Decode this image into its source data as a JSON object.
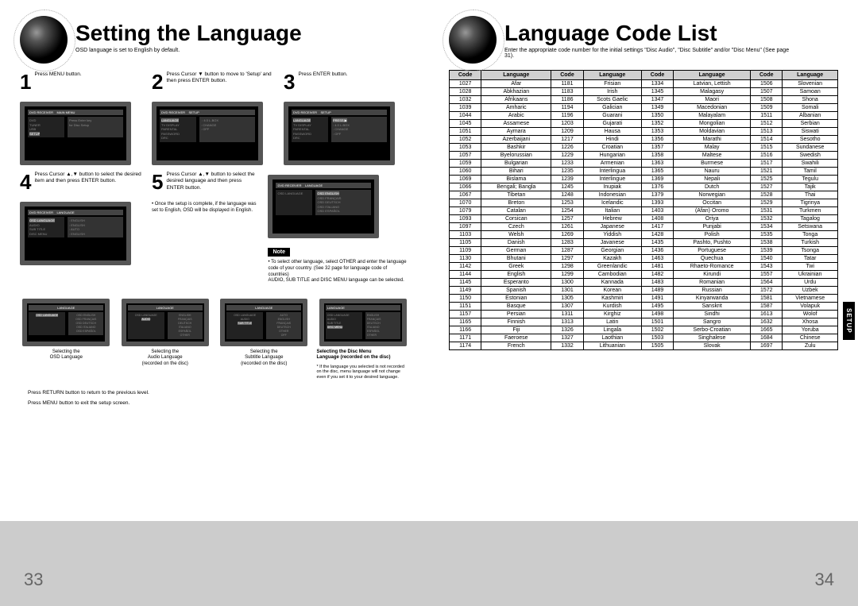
{
  "left": {
    "title": "Setting the Language",
    "subtitle": "OSD language is set to English by default.",
    "steps": {
      "s1": {
        "num": "1",
        "text": "Press MENU button."
      },
      "s2": {
        "num": "2",
        "text": "Press Cursor ▼ button to move to 'Setup' and then press ENTER button."
      },
      "s3": {
        "num": "3",
        "text": "Press ENTER button."
      },
      "s4": {
        "num": "4",
        "text": "Press Cursor ▲,▼ button to select the desired item and then press ENTER button."
      },
      "s5": {
        "num": "5",
        "text": "Press Cursor ▲,▼ button to select the desired language and then press ENTER button.",
        "sub": "• Once the setup is complete, if the language was set to English, OSD will be displayed in English."
      }
    },
    "note_label": "Note",
    "note_text": "• To select other language, select OTHER and enter the language code of your country. (See 32 page for language code of countries)\nAUDIO, SUB TITLE and DISC MENU language can be selected.",
    "bottom": {
      "b1": {
        "label1": "Selecting the",
        "label2": "OSD Language"
      },
      "b2": {
        "label1": "Selecting the",
        "label2": "Audio Language",
        "label3": "(recorded on the disc)"
      },
      "b3": {
        "label1": "Selecting the",
        "label2": "Subtitle Language",
        "label3": "(recorded on the disc)"
      },
      "b4": {
        "label1": "Selecting the Disc Menu",
        "label2": "Language (recorded on the disc)",
        "label3": "* If the language you selected is not recorded on the disc, menu language will not change even if you set it to your desired language."
      }
    },
    "footer1": "Press RETURN button to return to the previous level.",
    "footer2": "Press MENU button to exit the setup screen.",
    "page_num": "33"
  },
  "right": {
    "title": "Language Code List",
    "subtitle": "Enter the appropriate code number for the initial settings \"Disc Audio\", \"Disc Subtitle\" and/or \"Disc Menu\" (See page 31).",
    "headers": [
      "Code",
      "Language",
      "Code",
      "Language",
      "Code",
      "Language",
      "Code",
      "Language"
    ],
    "rows": [
      [
        "1027",
        "Afar",
        "1181",
        "Frisian",
        "1334",
        "Latvian, Lettish",
        "1506",
        "Slovenian"
      ],
      [
        "1028",
        "Abkhazian",
        "1183",
        "Irish",
        "1345",
        "Malagasy",
        "1507",
        "Samoan"
      ],
      [
        "1032",
        "Afrikaans",
        "1186",
        "Scots Gaelic",
        "1347",
        "Maori",
        "1508",
        "Shona"
      ],
      [
        "1039",
        "Amharic",
        "1194",
        "Galician",
        "1349",
        "Macedonian",
        "1509",
        "Somali"
      ],
      [
        "1044",
        "Arabic",
        "1196",
        "Guarani",
        "1350",
        "Malayalam",
        "1511",
        "Albanian"
      ],
      [
        "1045",
        "Assamese",
        "1203",
        "Gujarati",
        "1352",
        "Mongolian",
        "1512",
        "Serbian"
      ],
      [
        "1051",
        "Aymara",
        "1209",
        "Hausa",
        "1353",
        "Moldavian",
        "1513",
        "Siswati"
      ],
      [
        "1052",
        "Azerbaijani",
        "1217",
        "Hindi",
        "1356",
        "Marathi",
        "1514",
        "Sesotho"
      ],
      [
        "1053",
        "Bashkir",
        "1226",
        "Croatian",
        "1357",
        "Malay",
        "1515",
        "Sundanese"
      ],
      [
        "1057",
        "Byelorussian",
        "1229",
        "Hungarian",
        "1358",
        "Maltese",
        "1516",
        "Swedish"
      ],
      [
        "1059",
        "Bulgarian",
        "1233",
        "Armenian",
        "1363",
        "Burmese",
        "1517",
        "Swahili"
      ],
      [
        "1060",
        "Bihari",
        "1235",
        "Interlingua",
        "1365",
        "Nauru",
        "1521",
        "Tamil"
      ],
      [
        "1069",
        "Bislama",
        "1239",
        "Interlingue",
        "1369",
        "Nepali",
        "1525",
        "Tegulu"
      ],
      [
        "1066",
        "Bengali; Bangla",
        "1245",
        "Inupiak",
        "1376",
        "Dutch",
        "1527",
        "Tajik"
      ],
      [
        "1067",
        "Tibetan",
        "1248",
        "Indonesian",
        "1379",
        "Norwegian",
        "1528",
        "Thai"
      ],
      [
        "1070",
        "Breton",
        "1253",
        "Icelandic",
        "1393",
        "Occitan",
        "1529",
        "Tigrinya"
      ],
      [
        "1079",
        "Catalan",
        "1254",
        "Italian",
        "1403",
        "(Afan) Oromo",
        "1531",
        "Turkmen"
      ],
      [
        "1093",
        "Corsican",
        "1257",
        "Hebrew",
        "1408",
        "Oriya",
        "1532",
        "Tagalog"
      ],
      [
        "1097",
        "Czech",
        "1261",
        "Japanese",
        "1417",
        "Punjabi",
        "1534",
        "Setswana"
      ],
      [
        "1103",
        "Welsh",
        "1269",
        "Yiddish",
        "1428",
        "Polish",
        "1535",
        "Tonga"
      ],
      [
        "1105",
        "Danish",
        "1283",
        "Javanese",
        "1435",
        "Pashto, Pushto",
        "1538",
        "Turkish"
      ],
      [
        "1109",
        "German",
        "1287",
        "Georgian",
        "1436",
        "Portuguese",
        "1539",
        "Tsonga"
      ],
      [
        "1130",
        "Bhutani",
        "1297",
        "Kazakh",
        "1463",
        "Quechua",
        "1540",
        "Tatar"
      ],
      [
        "1142",
        "Greek",
        "1298",
        "Greenlandic",
        "1481",
        "Rhaeto-Romance",
        "1543",
        "Twi"
      ],
      [
        "1144",
        "English",
        "1299",
        "Cambodian",
        "1482",
        "Kirundi",
        "1557",
        "Ukrainian"
      ],
      [
        "1145",
        "Esperanto",
        "1300",
        "Kannada",
        "1483",
        "Romanian",
        "1564",
        "Urdu"
      ],
      [
        "1149",
        "Spanish",
        "1301",
        "Korean",
        "1489",
        "Russian",
        "1572",
        "Uzbek"
      ],
      [
        "1150",
        "Estonian",
        "1305",
        "Kashmiri",
        "1491",
        "Kinyarwanda",
        "1581",
        "Vietnamese"
      ],
      [
        "1151",
        "Basque",
        "1307",
        "Kurdish",
        "1495",
        "Sanskrit",
        "1587",
        "Volapuk"
      ],
      [
        "1157",
        "Persian",
        "1311",
        "Kirghiz",
        "1498",
        "Sindhi",
        "1613",
        "Wolof"
      ],
      [
        "1165",
        "Finnish",
        "1313",
        "Latin",
        "1501",
        "Sangro",
        "1632",
        "Xhosa"
      ],
      [
        "1166",
        "Fiji",
        "1326",
        "Lingala",
        "1502",
        "Serbo-Croatian",
        "1665",
        "Yoruba"
      ],
      [
        "1171",
        "Faeroese",
        "1327",
        "Laothian",
        "1503",
        "Singhalese",
        "1684",
        "Chinese"
      ],
      [
        "1174",
        "French",
        "1332",
        "Lithuanian",
        "1505",
        "Slovak",
        "1697",
        "Zulu"
      ]
    ],
    "side_tab": "SETUP",
    "page_num": "34"
  }
}
